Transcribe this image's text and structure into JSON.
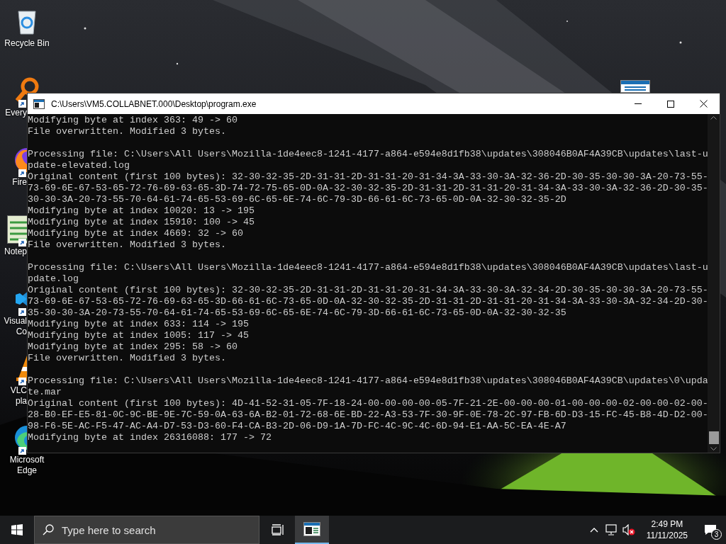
{
  "desktop": {
    "icons": [
      {
        "kind": "recycle",
        "shortcut": false,
        "covered": false,
        "labels": [
          "Recycle Bin"
        ]
      },
      {
        "kind": "magnifier",
        "shortcut": true,
        "covered": true,
        "labels": [
          "Every"
        ]
      },
      {
        "kind": "fox",
        "shortcut": true,
        "covered": true,
        "labels": [
          "Fire"
        ]
      },
      {
        "kind": "notepad",
        "shortcut": true,
        "covered": true,
        "labels": [
          "Notep"
        ]
      },
      {
        "kind": "code",
        "shortcut": true,
        "covered": true,
        "labels": [
          "Visual",
          "Co"
        ]
      },
      {
        "kind": "cone",
        "shortcut": true,
        "covered": true,
        "labels": [
          "VLC",
          "pla"
        ]
      },
      {
        "kind": "edge",
        "shortcut": true,
        "covered": false,
        "labels": [
          "Microsoft",
          "Edge"
        ]
      }
    ]
  },
  "window": {
    "title": "C:\\Users\\VM5.COLLABNET.000\\Desktop\\program.exe",
    "blocks": [
      [
        "Modifying byte at index 363: 49 -> 60",
        "File overwritten. Modified 3 bytes."
      ],
      [
        "Processing file: C:\\Users\\All Users\\Mozilla-1de4eec8-1241-4177-a864-e594e8d1fb38\\updates\\308046B0AF4A39CB\\updates\\last-u",
        "pdate-elevated.log",
        "Original content (first 100 bytes): 32-30-32-35-2D-31-31-2D-31-31-20-31-34-3A-33-30-3A-32-36-2D-30-35-30-30-3A-20-73-55-",
        "73-69-6E-67-53-65-72-76-69-63-65-3D-74-72-75-65-0D-0A-32-30-32-35-2D-31-31-2D-31-31-20-31-34-3A-33-30-3A-32-36-2D-30-35-",
        "30-30-3A-20-73-55-70-64-61-74-65-53-69-6C-65-6E-74-6C-79-3D-66-61-6C-73-65-0D-0A-32-30-32-35-2D",
        "Modifying byte at index 10020: 13 -> 195",
        "Modifying byte at index 15910: 100 -> 45",
        "Modifying byte at index 4669: 32 -> 60",
        "File overwritten. Modified 3 bytes."
      ],
      [
        "Processing file: C:\\Users\\All Users\\Mozilla-1de4eec8-1241-4177-a864-e594e8d1fb38\\updates\\308046B0AF4A39CB\\updates\\last-u",
        "pdate.log",
        "Original content (first 100 bytes): 32-30-32-35-2D-31-31-2D-31-31-20-31-34-3A-33-30-3A-32-34-2D-30-35-30-30-3A-20-73-55-",
        "73-69-6E-67-53-65-72-76-69-63-65-3D-66-61-6C-73-65-0D-0A-32-30-32-35-2D-31-31-2D-31-31-20-31-34-3A-33-30-3A-32-34-2D-30-",
        "35-30-30-3A-20-73-55-70-64-61-74-65-53-69-6C-65-6E-74-6C-79-3D-66-61-6C-73-65-0D-0A-32-30-32-35",
        "Modifying byte at index 633: 114 -> 195",
        "Modifying byte at index 1005: 117 -> 45",
        "Modifying byte at index 295: 58 -> 60",
        "File overwritten. Modified 3 bytes."
      ],
      [
        "Processing file: C:\\Users\\All Users\\Mozilla-1de4eec8-1241-4177-a864-e594e8d1fb38\\updates\\308046B0AF4A39CB\\updates\\0\\upda",
        "te.mar",
        "Original content (first 100 bytes): 4D-41-52-31-05-7F-18-24-00-00-00-00-05-7F-21-2E-00-00-00-01-00-00-00-02-00-00-02-00-",
        "28-B0-EF-E5-81-0C-9C-BE-9E-7C-59-0A-63-6A-B2-01-72-68-6E-BD-22-A3-53-7F-30-9F-0E-78-2C-97-FB-6D-D3-15-FC-45-B8-4D-D2-00-",
        "98-F6-5E-AC-F5-47-AC-A4-D7-53-D3-60-F4-CA-B3-2D-06-D9-1A-7D-FC-4C-9C-4C-6D-94-E1-AA-5C-EA-4E-A7",
        "Modifying byte at index 26316088: 177 -> 72"
      ]
    ]
  },
  "taskbar": {
    "search": {
      "placeholder": "Type here to search"
    },
    "apps": [
      {
        "kind": "console",
        "active": true
      }
    ],
    "tray": {
      "muted": true,
      "time": "2:49 PM",
      "date": "11/11/2025",
      "notifications": "3"
    }
  }
}
